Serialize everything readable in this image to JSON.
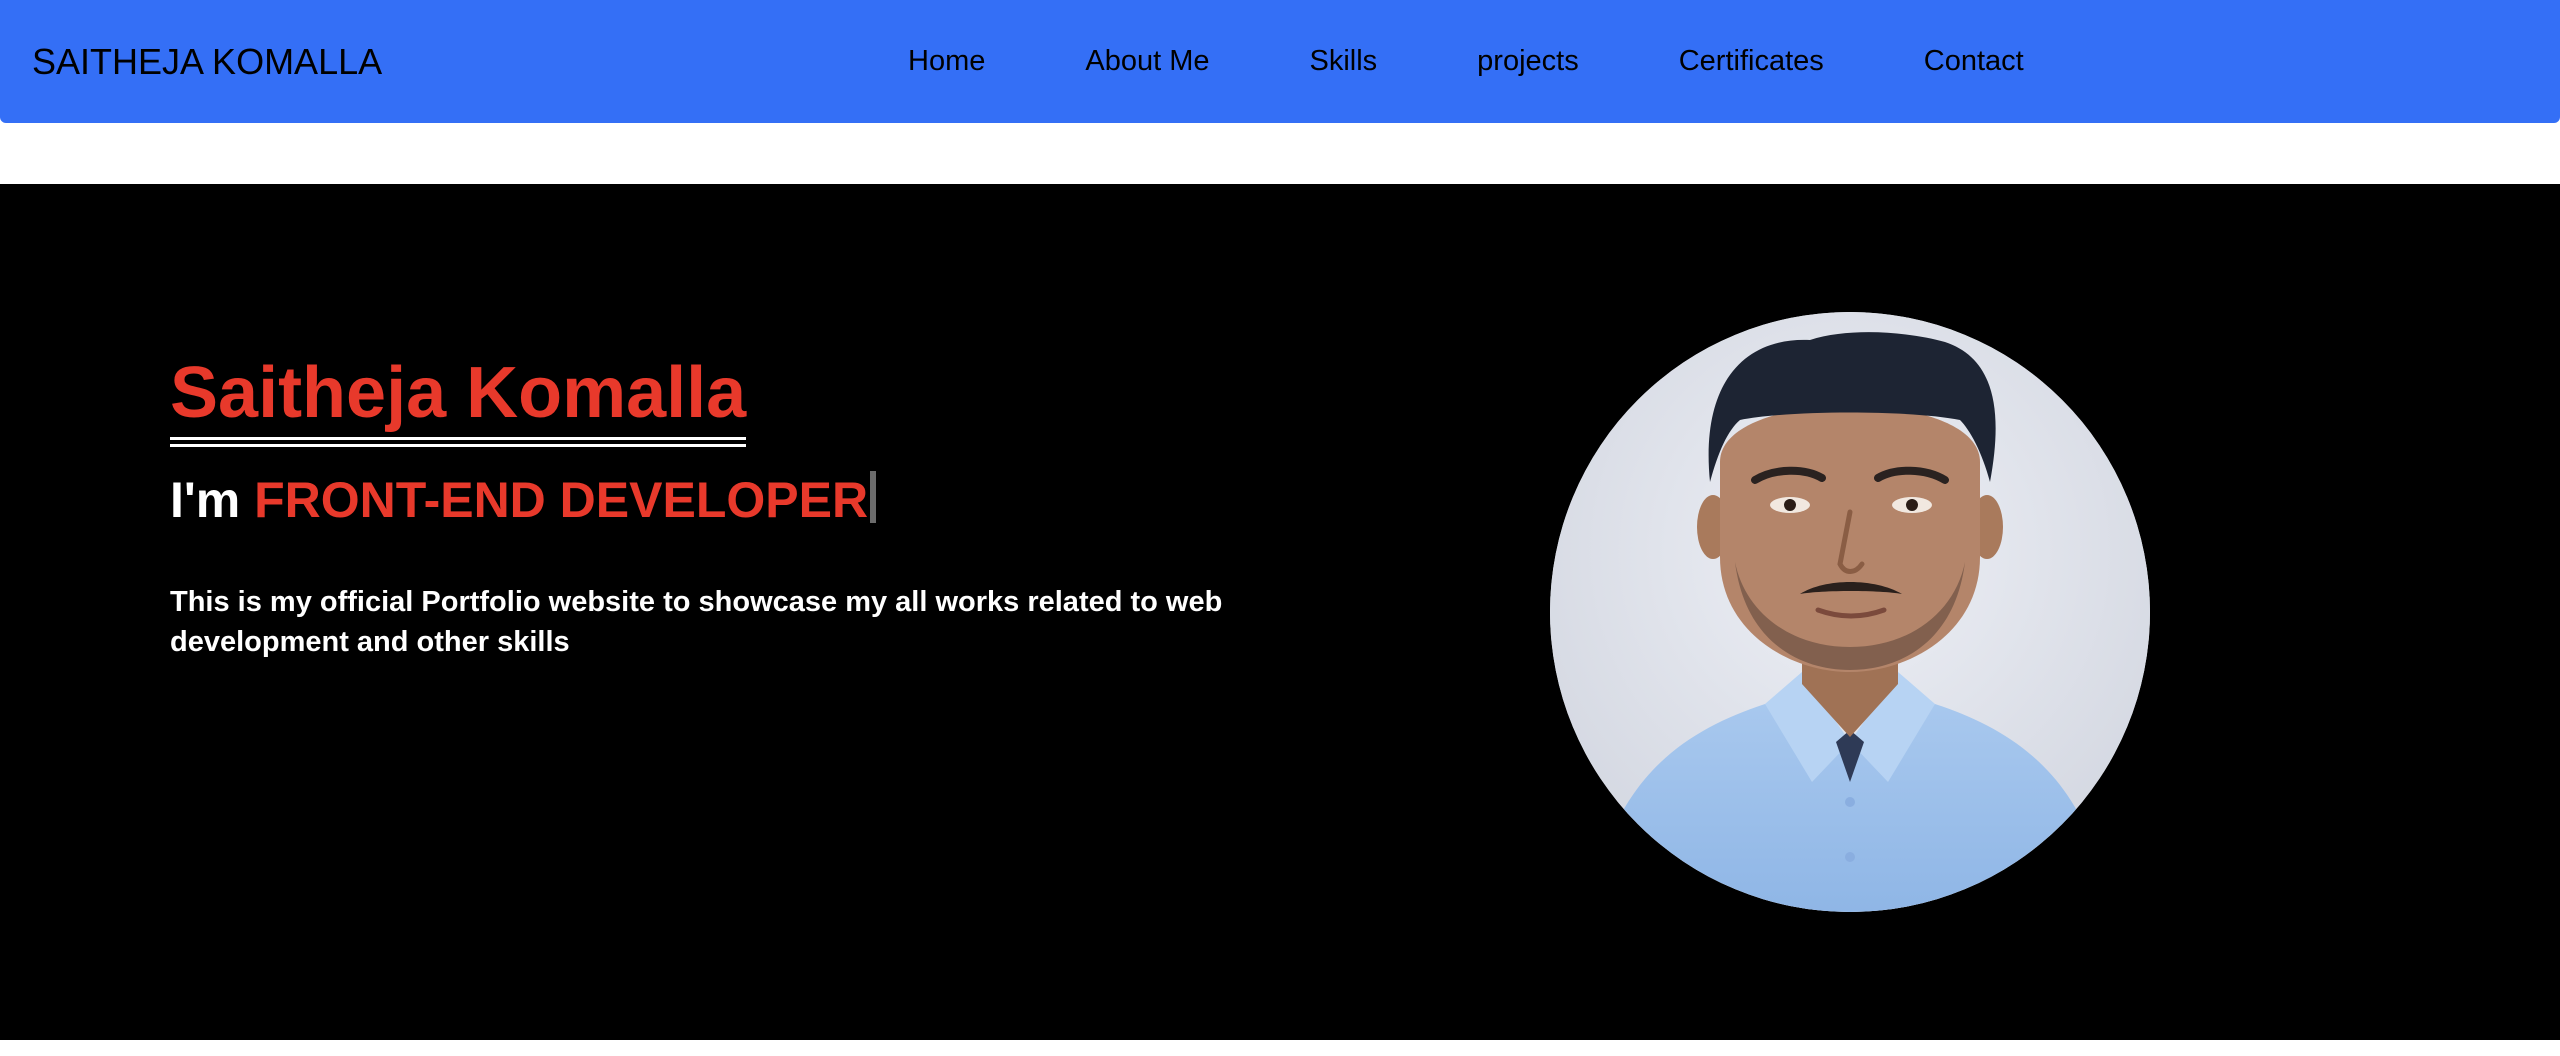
{
  "navbar": {
    "brand": "SAITHEJA KOMALLA",
    "links": [
      "Home",
      "About Me",
      "Skills",
      "projects",
      "Certificates",
      "Contact"
    ]
  },
  "hero": {
    "name": "Saitheja Komalla",
    "role_prefix": "I'm ",
    "role": "FRONT-END DEVELOPER",
    "description": "This is my official Portfolio website to showcase my all works related to web development and other skills",
    "photo_icon": "profile-photo"
  },
  "colors": {
    "navbar_bg": "#346ff6",
    "accent": "#e8392b",
    "hero_bg": "#000000",
    "text_light": "#ffffff"
  }
}
